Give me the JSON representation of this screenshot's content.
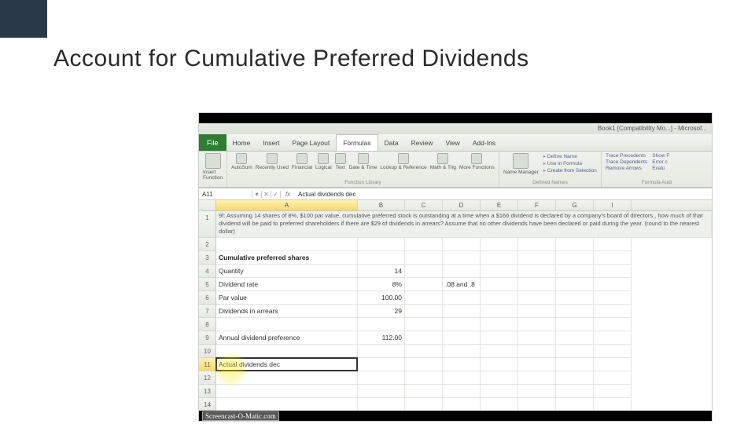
{
  "slide": {
    "title": "Account for Cumulative Preferred Dividends"
  },
  "excel": {
    "titlebar": "Book1 [Compatibility Mo...] - Microsof...",
    "tabs": {
      "file": "File",
      "home": "Home",
      "insert": "Insert",
      "page": "Page Layout",
      "formulas": "Formulas",
      "data": "Data",
      "review": "Review",
      "view": "View",
      "addins": "Add-Ins"
    },
    "toolbar": {
      "insertfn": "Insert Function",
      "autosum": "AutoSum",
      "recent": "Recently Used",
      "financial": "Financial",
      "logical": "Logical",
      "text": "Text",
      "date": "Date & Time",
      "lookup": "Lookup & Reference",
      "math": "Math & Trig",
      "more": "More Functions",
      "funclib": "Function Library",
      "namemgr": "Name Manager",
      "defname": "Define Name ",
      "usein": "Use in Formula ",
      "createfrom": "Create from Selection",
      "defgroup": "Defined Names",
      "traceprec": "Trace Precedents",
      "tracedep": "Trace Dependents",
      "remarr": "Remove Arrows",
      "showf": "Show F",
      "errc": "Error c",
      "eval": "Evalu",
      "audgroup": "Formula Audi"
    },
    "namebox": "A11",
    "formulabar_icons": {
      "cancel": "✕",
      "accept": "✓",
      "fx": "fx"
    },
    "formulabar": "Actual dividends dec",
    "cols": {
      "A": "A",
      "B": "B",
      "C": "C",
      "D": "D",
      "E": "E",
      "F": "F",
      "G": "G",
      "I": "I"
    },
    "rows": {
      "1": "9f:  Assuming  14 shares of 8%, $100 par value, cumulative preferred stock is outstanding at a time when a $166 dividend is declared by a company's board of directors., how much of that dividend will be paid to preferred shareholders if there are $29 of dividends in arrears? Assume that no other dividends have been declared or paid during the year. (round to the nearest dollar)",
      "3": "Cumulative preferred shares",
      "4a": "Quantity",
      "4b": "14",
      "5a": "Dividend rate",
      "5b": "8%",
      "5d": ".08 and .8",
      "6a": "Par value",
      "6b": "100.00",
      "7a": "Dividends in arrears",
      "7b": "29",
      "9a": "Annual dividend preference",
      "9b": "112.00",
      "11a": "Actual dividends dec"
    },
    "watermark": "Screencast-O-Matic.com"
  }
}
